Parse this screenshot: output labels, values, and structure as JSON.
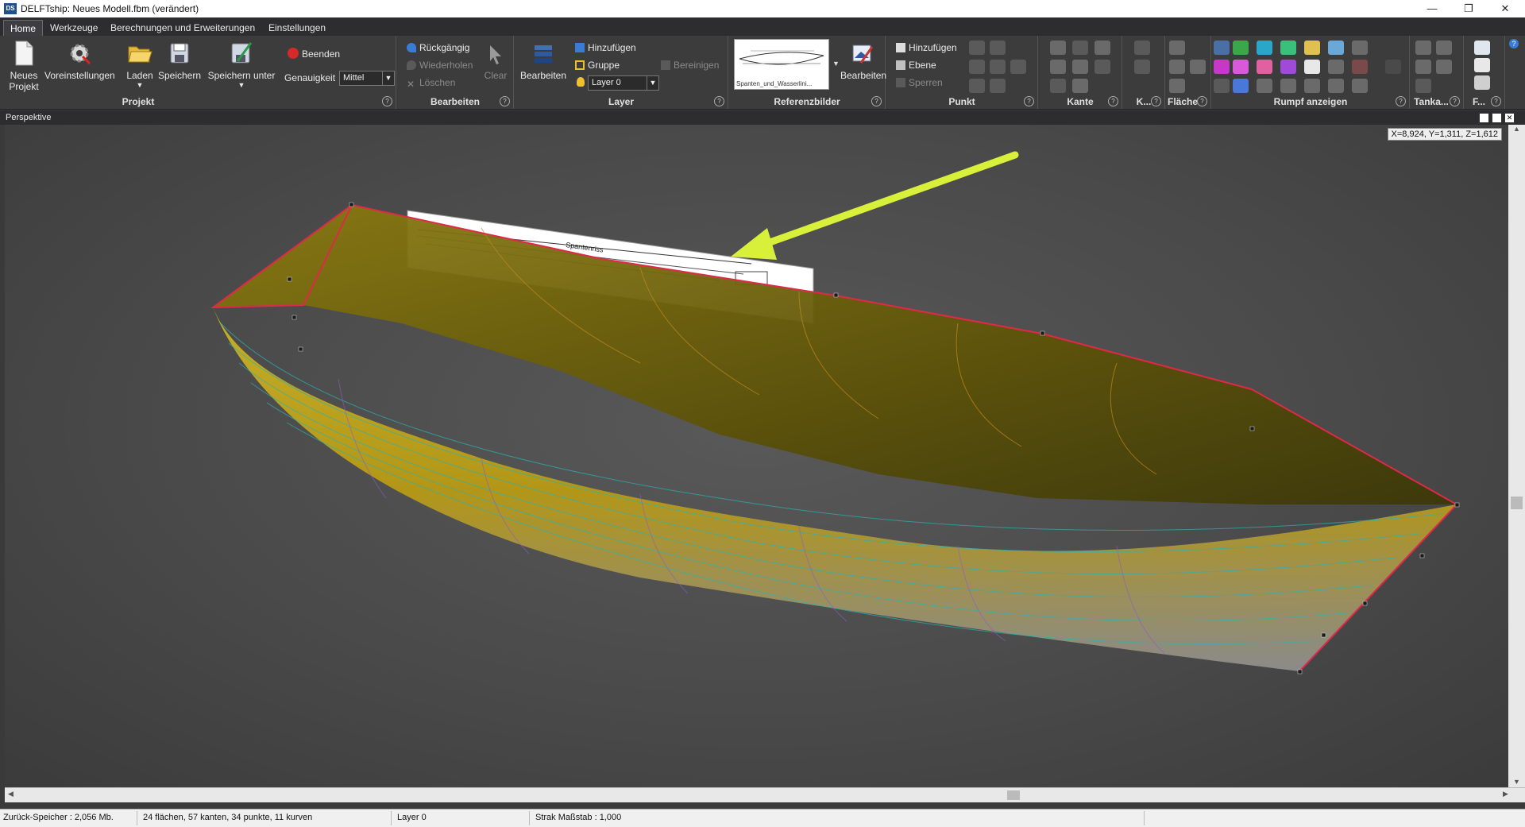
{
  "window": {
    "app_icon": "DS",
    "title": "DELFTship: Neues Modell.fbm (verändert)",
    "minimize": "—",
    "restore": "❐",
    "close": "✕"
  },
  "menu": {
    "tabs": [
      "Home",
      "Werkzeuge",
      "Berechnungen und Erweiterungen",
      "Einstellungen"
    ],
    "active": "Home"
  },
  "ribbon": {
    "projekt": {
      "label": "Projekt",
      "neues_projekt_1": "Neues",
      "neues_projekt_2": "Projekt",
      "voreinstellungen": "Voreinstellungen",
      "laden": "Laden",
      "speichern": "Speichern",
      "speichern_unter": "Speichern unter",
      "beenden": "Beenden",
      "genauigkeit_label": "Genauigkeit",
      "genauigkeit_value": "Mittel"
    },
    "bearbeiten": {
      "label": "Bearbeiten",
      "rueckgaengig": "Rückgängig",
      "wiederholen": "Wiederholen",
      "loeschen": "Löschen",
      "clear": "Clear"
    },
    "layer": {
      "label": "Layer",
      "bearbeiten": "Bearbeiten",
      "hinzufuegen": "Hinzufügen",
      "gruppe": "Gruppe",
      "layer_value": "Layer 0",
      "bereinigen": "Bereinigen"
    },
    "referenzbilder": {
      "label": "Referenzbilder",
      "thumb_caption": "Spanten_und_Wasserlini...",
      "bearbeiten": "Bearbeiten"
    },
    "punkt": {
      "label": "Punkt",
      "hinzufuegen": "Hinzufügen",
      "ebene": "Ebene",
      "sperren": "Sperren"
    },
    "kante": {
      "label": "Kante"
    },
    "k": {
      "label": "K..."
    },
    "flaeche": {
      "label": "Fläche"
    },
    "rumpf": {
      "label": "Rumpf anzeigen"
    },
    "tanka": {
      "label": "Tanka..."
    },
    "f": {
      "label": "F..."
    },
    "help": "?"
  },
  "viewport": {
    "title": "Perspektive",
    "coords": "X=8,924, Y=1,311, Z=1,612",
    "reference_image_caption": "Spantenriss"
  },
  "status": {
    "memory": "Zurück-Speicher : 2,056 Mb.",
    "counts": "24 flächen, 57 kanten, 34 punkte, 11 kurven",
    "layer": "Layer 0",
    "strak": "Strak Maßstab : 1,000"
  }
}
